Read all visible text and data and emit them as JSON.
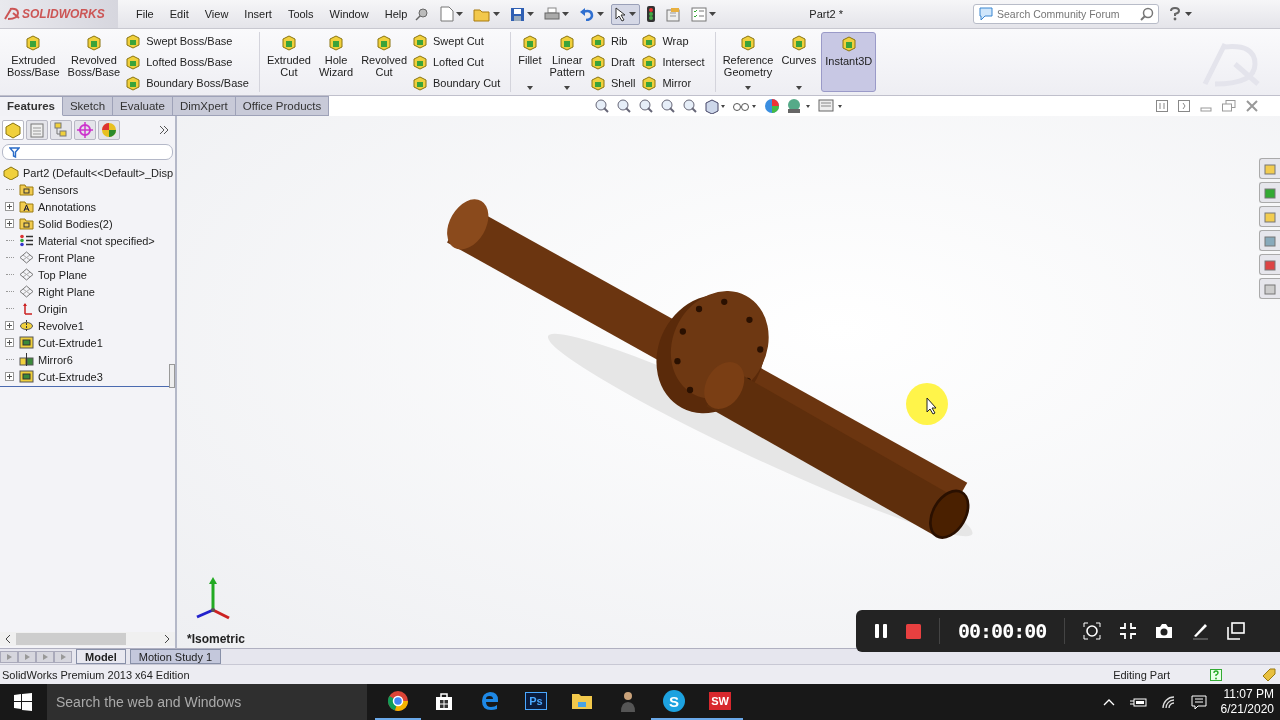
{
  "app": {
    "logo": "SOLIDWORKS",
    "menu": [
      "File",
      "Edit",
      "View",
      "Insert",
      "Tools",
      "Window",
      "Help"
    ],
    "title": "Part2 *",
    "search": {
      "placeholder": "Search Community Forum"
    }
  },
  "ribbon": [
    {
      "items": [
        {
          "kind": "large",
          "label": "Extruded Boss/Base",
          "dropdown": false,
          "selected": false
        },
        {
          "kind": "large",
          "label": "Revolved Boss/Base",
          "dropdown": false,
          "selected": false
        },
        {
          "kind": "stack",
          "labels": [
            "Swept Boss/Base",
            "Lofted Boss/Base",
            "Boundary Boss/Base"
          ]
        }
      ]
    },
    {
      "items": [
        {
          "kind": "large",
          "label": "Extruded Cut",
          "dropdown": false,
          "selected": false
        },
        {
          "kind": "large",
          "label": "Hole Wizard",
          "dropdown": false,
          "selected": false
        },
        {
          "kind": "large",
          "label": "Revolved Cut",
          "dropdown": false,
          "selected": false
        },
        {
          "kind": "stack",
          "labels": [
            "Swept Cut",
            "Lofted Cut",
            "Boundary Cut"
          ]
        }
      ]
    },
    {
      "items": [
        {
          "kind": "large",
          "label": "Fillet",
          "dropdown": true,
          "selected": false
        },
        {
          "kind": "large",
          "label": "Linear Pattern",
          "dropdown": true,
          "selected": false
        },
        {
          "kind": "stack",
          "labels": [
            "Rib",
            "Draft",
            "Shell"
          ]
        },
        {
          "kind": "stack",
          "labels": [
            "Wrap",
            "Intersect",
            "Mirror"
          ]
        }
      ]
    },
    {
      "items": [
        {
          "kind": "large",
          "label": "Reference Geometry",
          "dropdown": true,
          "selected": false
        },
        {
          "kind": "large",
          "label": "Curves",
          "dropdown": true,
          "selected": false
        },
        {
          "kind": "large",
          "label": "Instant3D",
          "dropdown": false,
          "selected": true
        }
      ]
    }
  ],
  "tabs": [
    {
      "label": "Features",
      "selected": true
    },
    {
      "label": "Sketch",
      "selected": false
    },
    {
      "label": "Evaluate",
      "selected": false
    },
    {
      "label": "DimXpert",
      "selected": false
    },
    {
      "label": "Office Products",
      "selected": false
    }
  ],
  "tree": {
    "root": "Part2  (Default<<Default>_Disp",
    "children": [
      {
        "label": "Sensors",
        "kind": "folder",
        "collapsed": false
      },
      {
        "label": "Annotations",
        "kind": "annotation",
        "collapsed": true
      },
      {
        "label": "Solid Bodies(2)",
        "kind": "folder",
        "collapsed": true
      },
      {
        "label": "Material <not specified>",
        "kind": "material",
        "collapsed": false
      },
      {
        "label": "Front Plane",
        "kind": "plane",
        "collapsed": false
      },
      {
        "label": "Top Plane",
        "kind": "plane",
        "collapsed": false
      },
      {
        "label": "Right Plane",
        "kind": "plane",
        "collapsed": false
      },
      {
        "label": "Origin",
        "kind": "origin",
        "collapsed": false
      },
      {
        "label": "Revolve1",
        "kind": "revolve",
        "collapsed": true
      },
      {
        "label": "Cut-Extrude1",
        "kind": "cut",
        "collapsed": true
      },
      {
        "label": "Mirror6",
        "kind": "mirror",
        "collapsed": false
      },
      {
        "label": "Cut-Extrude3",
        "kind": "cut",
        "collapsed": true
      }
    ]
  },
  "viewport": {
    "view_label": "*Isometric"
  },
  "bottom_tabs": [
    {
      "label": "Model",
      "selected": true
    },
    {
      "label": "Motion Study 1",
      "selected": false
    }
  ],
  "status_bar": {
    "edition": "SolidWorks Premium 2013 x64 Edition",
    "mode": "Editing Part"
  },
  "recorder": {
    "time": "00:00:00"
  },
  "taskbar": {
    "search": {
      "placeholder": "Search the web and Windows"
    },
    "apps": [
      {
        "kind": "chrome",
        "running": true
      },
      {
        "kind": "store",
        "running": false
      },
      {
        "kind": "edge",
        "running": false
      },
      {
        "kind": "photoshop",
        "label": "Ps",
        "running": false
      },
      {
        "kind": "explorer",
        "running": false
      },
      {
        "kind": "person",
        "running": false
      },
      {
        "kind": "skype",
        "label": "S",
        "running": true
      },
      {
        "kind": "solidworks",
        "label": "SW",
        "running": true
      }
    ],
    "time": "11:07 PM",
    "date": "6/21/2020"
  }
}
